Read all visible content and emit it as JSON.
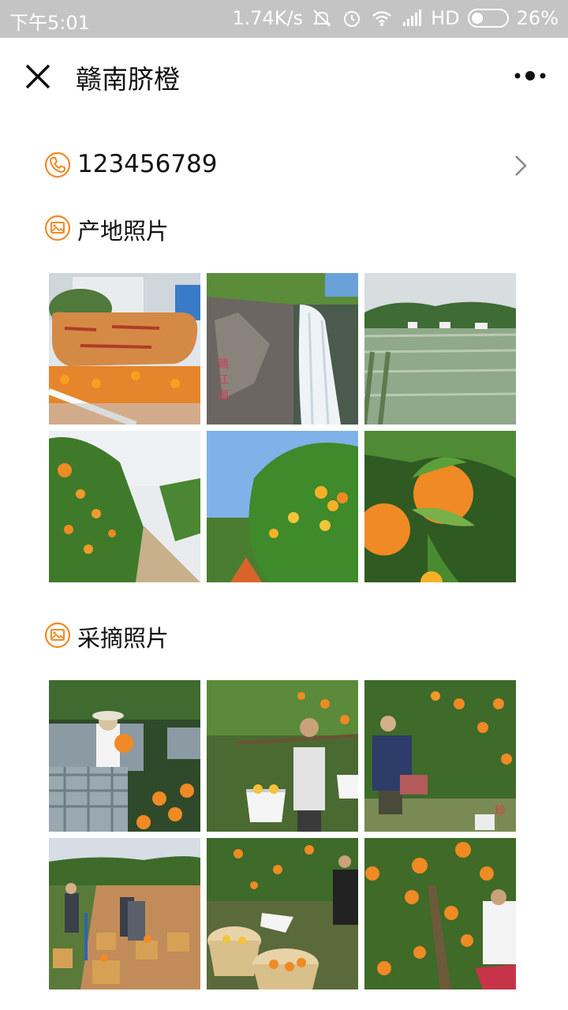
{
  "status_bar": {
    "time": "下午5:01",
    "network_speed": "1.74K/s",
    "hd": "HD",
    "battery": "26%"
  },
  "title_bar": {
    "title": "赣南脐橙",
    "close_icon": "close-icon",
    "more_icon": "more-dots-icon"
  },
  "contact": {
    "phone": "123456789",
    "icon": "phone-icon"
  },
  "sections": [
    {
      "label": "产地照片",
      "icon": "image-icon",
      "photos": [
        "photo-monument-sign",
        "photo-waterfall",
        "photo-rice-field",
        "photo-orchard-row",
        "photo-orange-tree-sky",
        "photo-orange-closeup"
      ]
    },
    {
      "label": "采摘照片",
      "icon": "image-icon",
      "photos": [
        "photo-crates-harvest",
        "photo-carrying-baskets",
        "photo-farmer-orchard",
        "photo-field-baskets",
        "photo-baskets-ground",
        "photo-picking-tree"
      ]
    }
  ],
  "colors": {
    "accent": "#f08a24",
    "status_bar_bg": "#c4c4c4"
  }
}
